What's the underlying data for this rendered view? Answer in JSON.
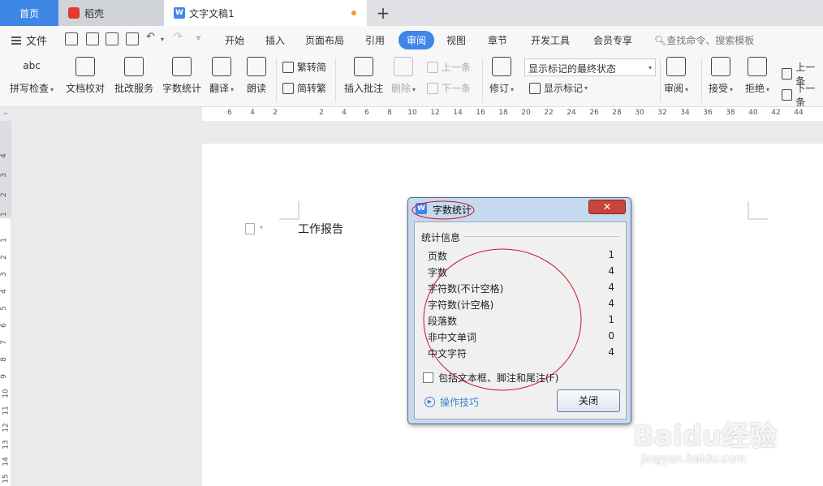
{
  "tabs": {
    "home": "首页",
    "daoke": "稻壳",
    "doc": "文字文稿1",
    "add": "+"
  },
  "menu": {
    "file": "文件",
    "items": [
      "开始",
      "插入",
      "页面布局",
      "引用",
      "审阅",
      "视图",
      "章节",
      "开发工具",
      "会员专享"
    ],
    "active": "审阅",
    "search": "查找命令、搜索模板"
  },
  "ribbon": {
    "spell_check": "拼写检查",
    "doc_proof": "文档校对",
    "review_service": "批改服务",
    "word_count": "字数统计",
    "translate": "翻译",
    "read_aloud": "朗读",
    "trad_convert": "繁转简",
    "simp_convert": "简转繁",
    "insert_comment": "插入批注",
    "delete": "删除",
    "prev": "上一条",
    "next": "下一条",
    "track": "修订",
    "markup_state": "显示标记的最终状态",
    "show_markup": "显示标记",
    "review": "审阅",
    "accept": "接受",
    "reject": "拒绝",
    "prev_right": "上一条",
    "next_right": "下一条",
    "abc": "abc"
  },
  "ruler": {
    "h_ticks": [
      "6",
      "4",
      "2",
      "2",
      "4",
      "6",
      "8",
      "10",
      "12",
      "14",
      "16",
      "18",
      "20",
      "22",
      "24",
      "26",
      "28",
      "30",
      "32",
      "34",
      "36",
      "38",
      "40",
      "42",
      "44"
    ],
    "v_ticks": [
      "4",
      "3",
      "2",
      "1",
      "1",
      "2",
      "3",
      "4",
      "5",
      "6",
      "7",
      "8",
      "9",
      "10",
      "11",
      "12",
      "13",
      "14",
      "15"
    ]
  },
  "document": {
    "text": "工作报告"
  },
  "dialog": {
    "title": "字数统计",
    "close_x": "✕",
    "group": "统计信息",
    "rows": [
      {
        "label": "页数",
        "value": "1"
      },
      {
        "label": "字数",
        "value": "4"
      },
      {
        "label": "字符数(不计空格)",
        "value": "4"
      },
      {
        "label": "字符数(计空格)",
        "value": "4"
      },
      {
        "label": "段落数",
        "value": "1"
      },
      {
        "label": "非中文单词",
        "value": "0"
      },
      {
        "label": "中文字符",
        "value": "4"
      }
    ],
    "checkbox": "包括文本框、脚注和尾注(F)",
    "tips": "操作技巧",
    "close_button": "关闭"
  },
  "watermark": {
    "brand": "Baidu经验",
    "url": "jingyan.baidu.com"
  },
  "colors": {
    "accent": "#3f87e6",
    "annotation": "#c0182a"
  }
}
